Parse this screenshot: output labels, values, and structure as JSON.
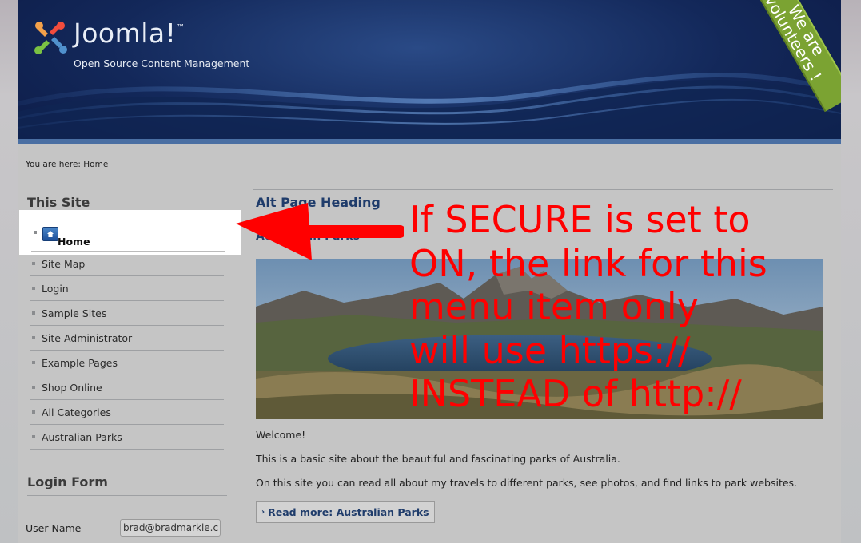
{
  "header": {
    "logo_text": "Joomla!",
    "logo_trademark": "™",
    "tagline": "Open Source Content Management",
    "ribbon_line1": "We are",
    "ribbon_line2": "volunteers !"
  },
  "breadcrumb": "You are here: Home",
  "sidebar": {
    "title": "This Site",
    "items": [
      {
        "label": "Home"
      },
      {
        "label": "Site Map"
      },
      {
        "label": "Login"
      },
      {
        "label": "Sample Sites"
      },
      {
        "label": "Site Administrator"
      },
      {
        "label": "Example Pages"
      },
      {
        "label": "Shop Online"
      },
      {
        "label": "All Categories"
      },
      {
        "label": "Australian Parks"
      }
    ],
    "login_title": "Login Form",
    "username_label": "User Name",
    "username_value": "brad@bradmarkle.c"
  },
  "main": {
    "page_heading": "Alt Page Heading",
    "article_title": "Australian Parks",
    "paragraphs": [
      "Welcome!",
      "This is a basic site about the beautiful and fascinating parks of Australia.",
      "On this site you can read all about my travels to different parks, see photos, and find links to park websites."
    ],
    "read_more": "Read more: Australian Parks"
  },
  "annotation": {
    "lines": [
      "If SECURE is set to",
      "ON, the link for this",
      "menu item only",
      "will use https://",
      "INSTEAD of http://"
    ],
    "color": "#ff0000"
  },
  "colors": {
    "header_bg": "#13285a",
    "link": "#1f3c6b",
    "ribbon": "#7ba332"
  }
}
